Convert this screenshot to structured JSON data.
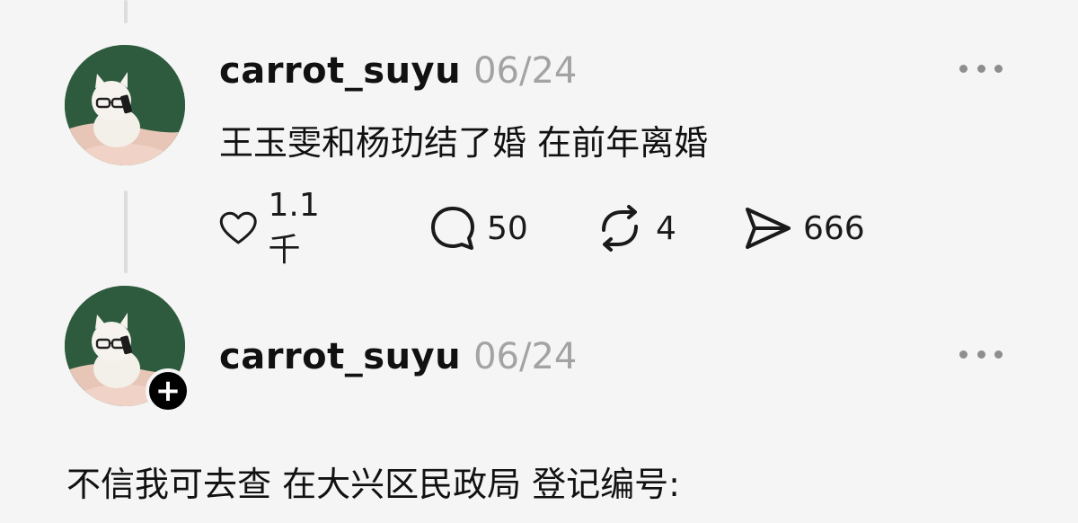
{
  "posts": [
    {
      "username": "carrot_suyu",
      "timestamp": "06/24",
      "text": "王玉雯和杨玏结了婚 在前年离婚",
      "stats": {
        "likes": "1.1千",
        "comments": "50",
        "reposts": "4",
        "shares": "666"
      }
    },
    {
      "username": "carrot_suyu",
      "timestamp": "06/24",
      "text": "不信我可去查 在大兴区民政局 登记编号:"
    }
  ],
  "icons": {
    "like": "heart-icon",
    "comment": "comment-bubble-icon",
    "repost": "repost-icon",
    "share": "send-icon",
    "more": "more-dots-icon",
    "follow": "plus-icon"
  },
  "colors": {
    "background": "#f5f5f5",
    "username": "#111111",
    "timestamp": "#a3a3a3",
    "thread_line": "#dcdcdc"
  }
}
